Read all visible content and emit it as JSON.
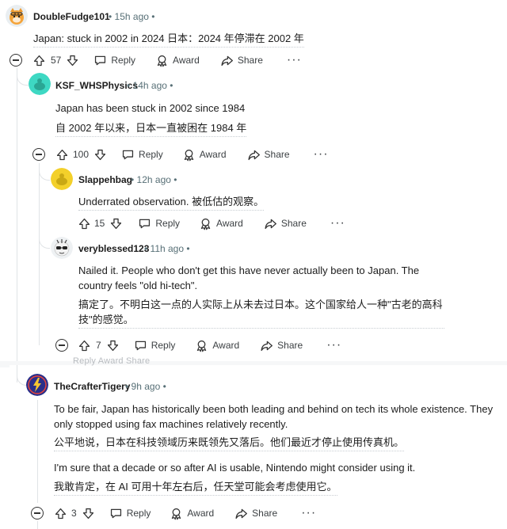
{
  "comments": {
    "c1": {
      "author": "DoubleFudge101",
      "time": "15h ago",
      "text": "Japan: stuck in 2002 in 2024 日本：2024 年停滞在 2002 年",
      "votes": "57",
      "reply": "Reply",
      "award": "Award",
      "share": "Share"
    },
    "c2": {
      "author": "KSF_WHSPhysics",
      "time": "14h ago",
      "text_en": "Japan has been stuck in 2002 since 1984",
      "text_cn": "自 2002 年以来，日本一直被困在 1984 年",
      "votes": "100",
      "reply": "Reply",
      "award": "Award",
      "share": "Share"
    },
    "c3": {
      "author": "Slappehbag",
      "time": "12h ago",
      "text": "Underrated observation. 被低估的观察。",
      "votes": "15",
      "reply": "Reply",
      "award": "Award",
      "share": "Share"
    },
    "c4": {
      "author": "veryblessed123",
      "time": "11h ago",
      "text_en": "Nailed it. People who don't get this have never actually been to Japan. The country feels \"old hi-tech\".",
      "text_cn": "搞定了。不明白这一点的人实际上从未去过日本。这个国家给人一种\"古老的高科技\"的感觉。",
      "votes": "7",
      "reply": "Reply",
      "award": "Award",
      "share": "Share"
    },
    "c5": {
      "author": "TheCrafterTigery",
      "time": "9h ago",
      "text_en1": "To be fair, Japan has historically been both leading and behind on tech its whole existence. They only stopped using fax machines relatively recently.",
      "text_cn1": "公平地说，日本在科技领域历来既领先又落后。他们最近才停止使用传真机。",
      "text_en2": "I'm sure that a decade or so after AI is usable, Nintendo might consider using it.",
      "text_cn2": "我敢肯定，在 AI 可用十年左右后，任天堂可能会考虑使用它。",
      "votes": "3",
      "reply": "Reply",
      "award": "Award",
      "share": "Share"
    }
  },
  "ghost_row": "Reply   Award   Share",
  "colors": {
    "ksf_avatar": "#3ed8c3",
    "slappeh_avatar": "#f3d02a",
    "crafter_avatar": "#2a2f8a",
    "meta_text": "#576f76",
    "thread_line": "#e0e3e6"
  },
  "icons": [
    "upvote-icon",
    "downvote-icon",
    "reply-icon",
    "award-icon",
    "share-icon",
    "more-icon",
    "collapse-icon"
  ]
}
